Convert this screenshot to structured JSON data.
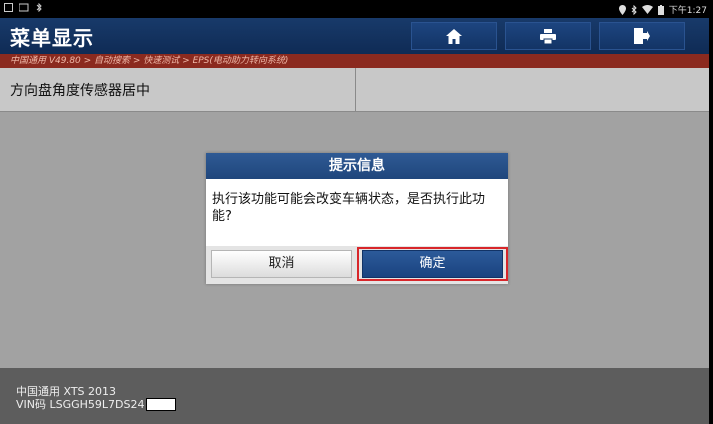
{
  "status_bar": {
    "time": "下午1:27",
    "icons": [
      "screen-icon",
      "signal-icon",
      "location-icon",
      "bluetooth-icon",
      "wifi-icon",
      "battery-icon"
    ]
  },
  "header": {
    "title": "菜单显示",
    "buttons": [
      "home-icon",
      "print-icon",
      "exit-icon"
    ]
  },
  "breadcrumb": "中国通用 V49.80 > 自动搜索 > 快速测试 > EPS(电动助力转向系统)",
  "menu": {
    "items": [
      {
        "label": "方向盘角度传感器居中"
      }
    ]
  },
  "dialog": {
    "title": "提示信息",
    "message": "执行该功能可能会改变车辆状态，是否执行此功能?",
    "cancel_label": "取消",
    "ok_label": "确定",
    "highlight_color": "#d8262a"
  },
  "footer": {
    "vehicle": "中国通用 XTS 2013",
    "vin": "VIN码 LSGGH59L7DS24"
  },
  "colors": {
    "header": "#183a6a",
    "breadcrumb_bg": "#8b2a1f",
    "content_bg": "#a2a2a2",
    "ok_button": "#2c5a9a"
  }
}
